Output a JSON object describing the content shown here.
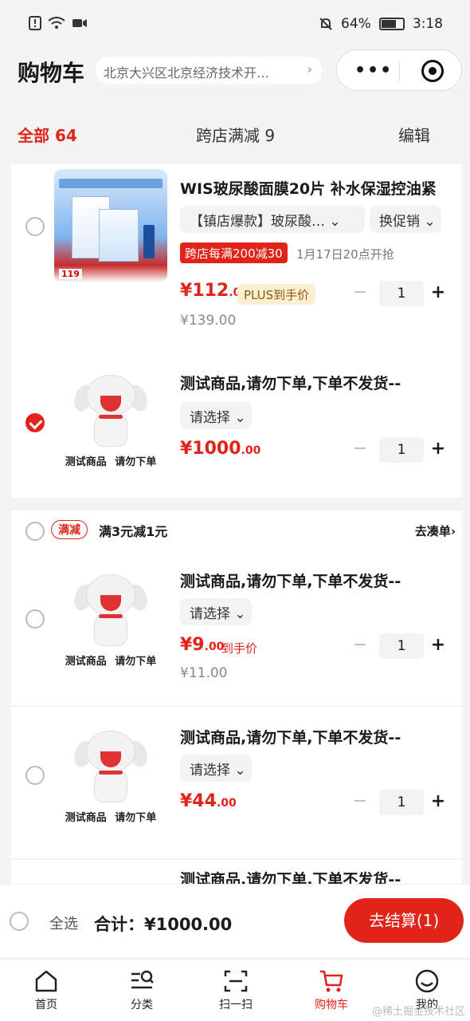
{
  "status_bar": {
    "battery": "64%",
    "time": "3:18"
  },
  "header": {
    "title": "购物车",
    "address": "北京大兴区北京经济技术开…",
    "address_chevron": "›",
    "menu_dots": "•••"
  },
  "tabs": {
    "all_label": "全部",
    "all_count": "64",
    "cross_store": "跨店满减 9",
    "edit": "编辑"
  },
  "items": [
    {
      "name": "WIS玻尿酸面膜20片 补水保湿控油紧",
      "spec": "【镇店爆款】玻尿酸…",
      "promo_switch": "换促销",
      "badge": "跨店每满200减30",
      "badge_note": "1月17日20点开抢",
      "price_int": "¥112",
      "price_dec": ".05",
      "plus_badge": "PLUS到手价",
      "orig_price": "¥139.00",
      "qty": "1",
      "thumb_price": "119"
    },
    {
      "name": "测试商品,请勿下单,下单不发货--",
      "spec": "请选择",
      "price_int": "¥1000",
      "price_dec": ".00",
      "qty": "1",
      "thumb_caption": "测试商品 请勿下单"
    },
    {
      "name": "测试商品,请勿下单,下单不发货--",
      "spec": "请选择",
      "price_int": "¥9",
      "price_dec": ".00",
      "daoshou": "到手价",
      "orig_price": "¥11.00",
      "qty": "1",
      "thumb_caption": "测试商品 请勿下单"
    },
    {
      "name": "测试商品,请勿下单,下单不发货--",
      "spec": "请选择",
      "price_int": "¥44",
      "price_dec": ".00",
      "qty": "1",
      "thumb_caption": "测试商品 请勿下单"
    },
    {
      "name": "测试商品,请勿下单,下单不发货--"
    }
  ],
  "promo_group": {
    "tag": "满减",
    "text": "满3元减1元",
    "action": "去凑单›"
  },
  "bottom": {
    "select_all": "全选",
    "total": "合计：¥1000.00",
    "checkout": "去结算(1)"
  },
  "tabbar": [
    {
      "label": "首页",
      "icon": "home-icon"
    },
    {
      "label": "分类",
      "icon": "category-search-icon"
    },
    {
      "label": "扫一扫",
      "icon": "scan-icon"
    },
    {
      "label": "购物车",
      "icon": "cart-icon"
    },
    {
      "label": "我的",
      "icon": "profile-icon"
    }
  ],
  "watermark": "@稀土掘金技术社区",
  "colors": {
    "accent": "#e2231a"
  }
}
